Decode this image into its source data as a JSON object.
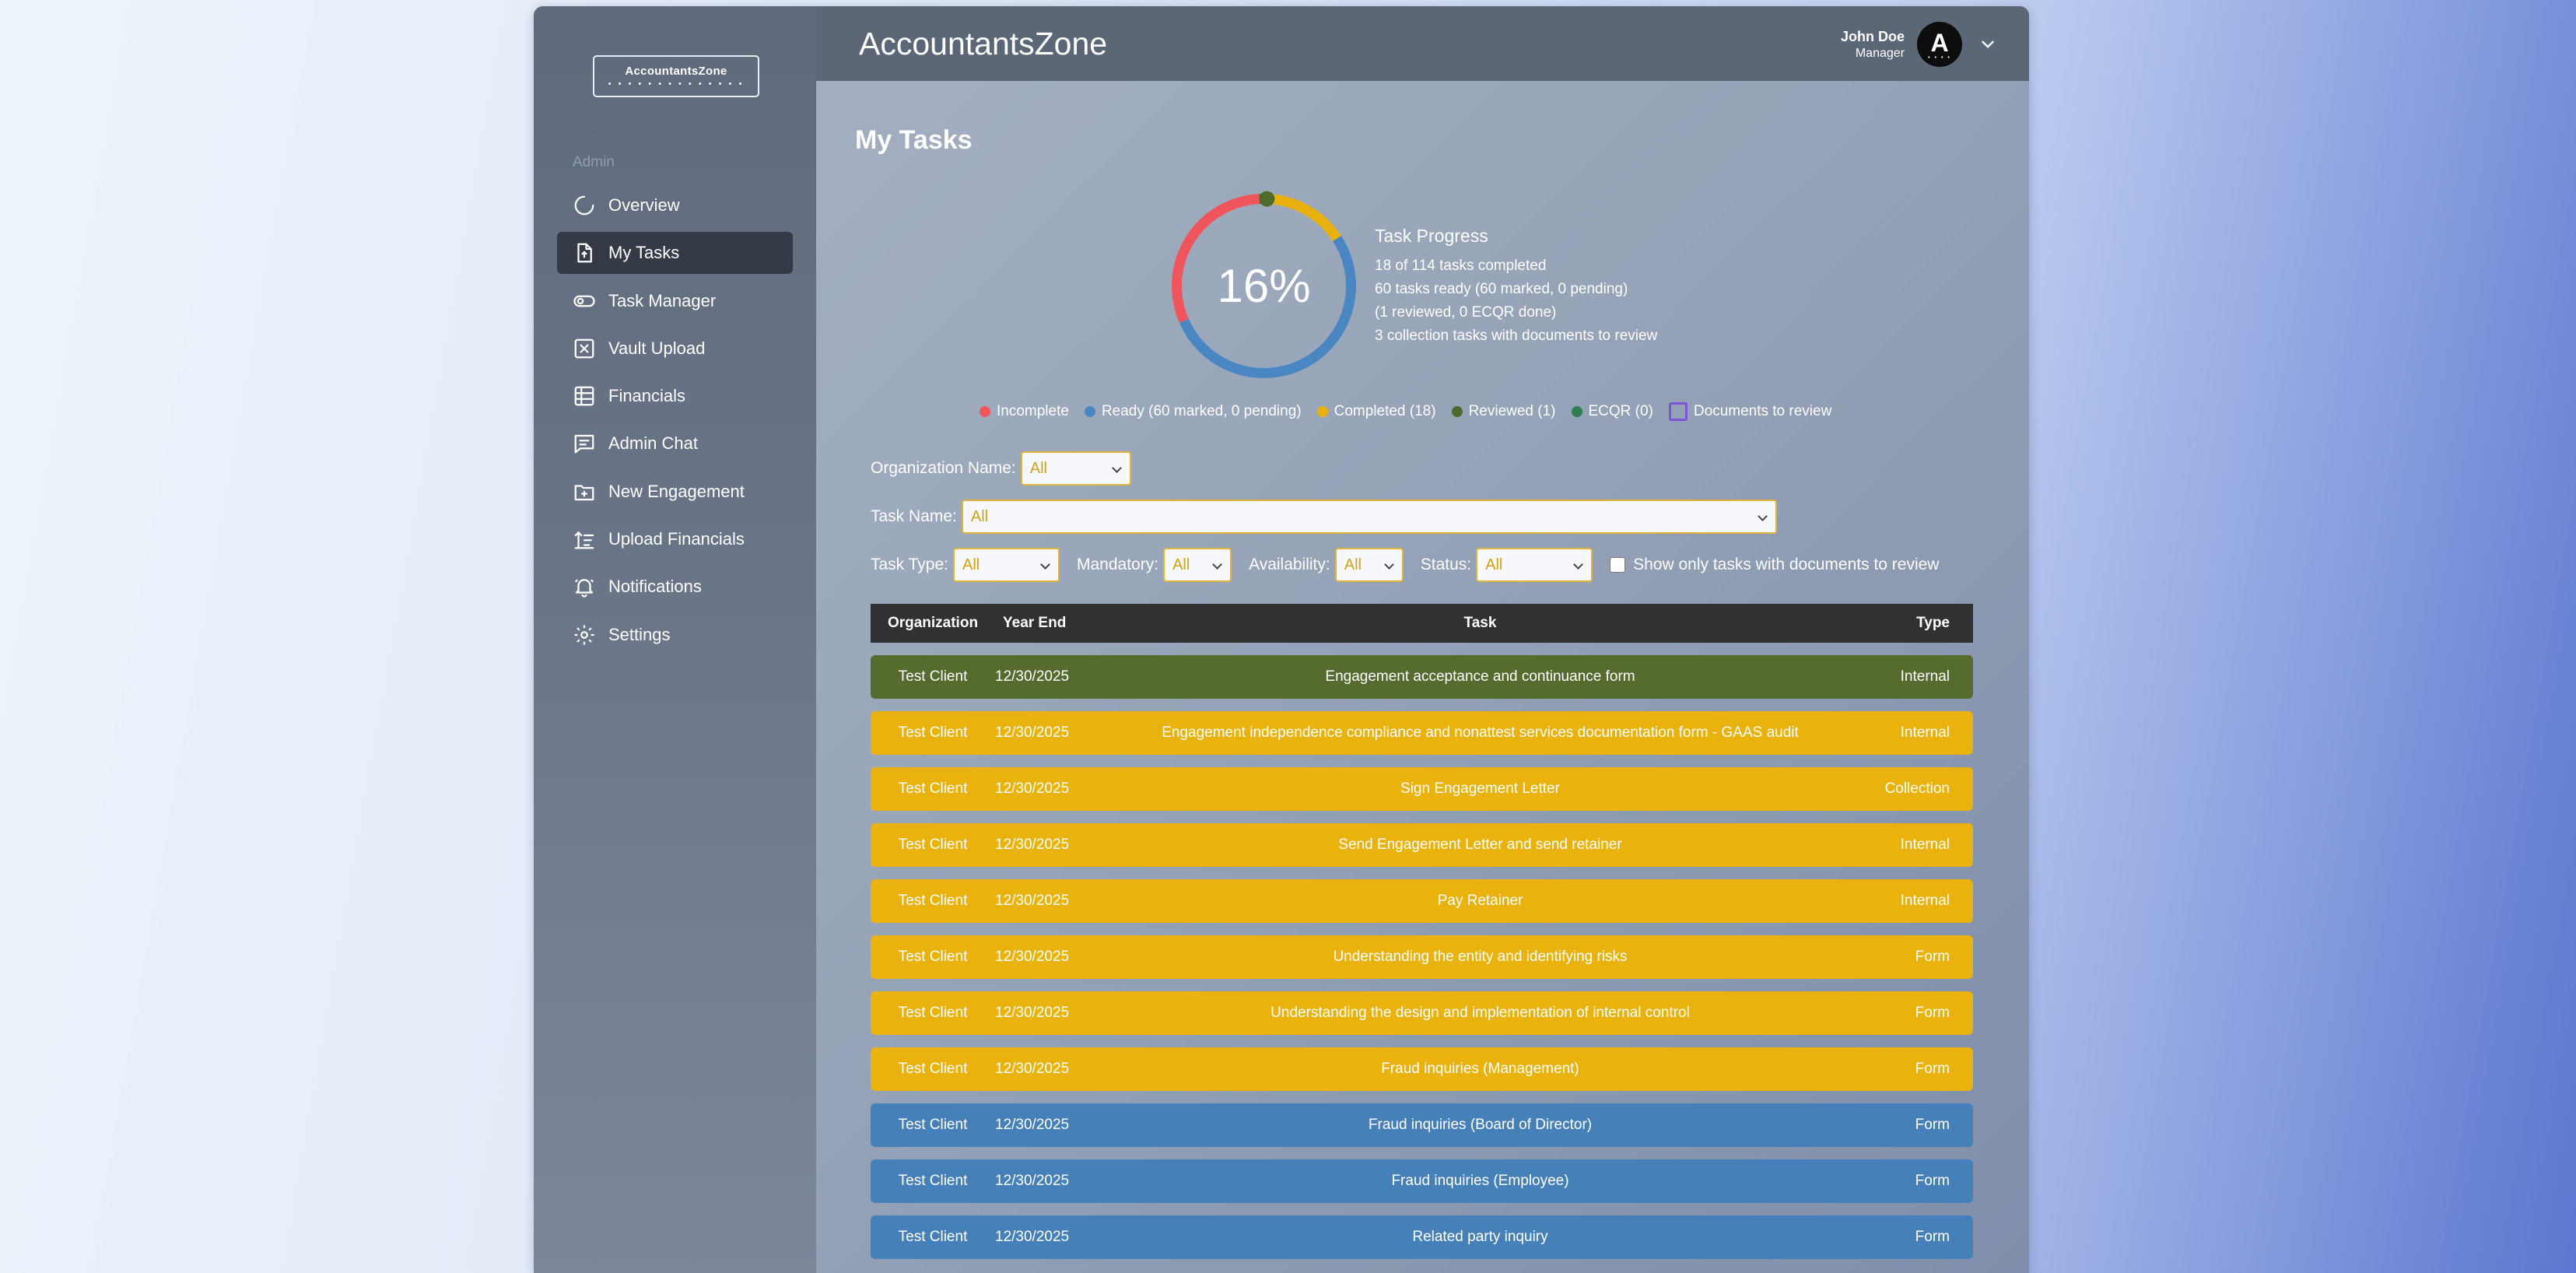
{
  "app": {
    "title": "AccountantsZone",
    "logo_title": "AccountantsZone",
    "logo_dots": "• • • • • • • • • • • •   • •"
  },
  "sidebar": {
    "section_label": "Admin",
    "items": [
      {
        "label": "Overview",
        "icon": "overview-icon"
      },
      {
        "label": "My Tasks",
        "icon": "task-file-icon",
        "active": true
      },
      {
        "label": "Task Manager",
        "icon": "toggle-icon"
      },
      {
        "label": "Vault Upload",
        "icon": "vault-icon"
      },
      {
        "label": "Financials",
        "icon": "table-icon"
      },
      {
        "label": "Admin Chat",
        "icon": "chat-icon"
      },
      {
        "label": "New Engagement",
        "icon": "folder-plus-icon"
      },
      {
        "label": "Upload Financials",
        "icon": "upload-list-icon"
      },
      {
        "label": "Notifications",
        "icon": "bell-icon"
      },
      {
        "label": "Settings",
        "icon": "gear-icon"
      }
    ]
  },
  "header": {
    "user_name": "John Doe",
    "user_role": "Manager",
    "avatar_letter": "A",
    "avatar_sub": "• • • •"
  },
  "page": {
    "title": "My Tasks"
  },
  "progress": {
    "percent_label": "16%",
    "title": "Task Progress",
    "lines": [
      "18 of 114 tasks completed",
      "60 tasks ready (60 marked, 0 pending)",
      "(1 reviewed, 0 ECQR done)",
      "3 collection tasks with documents to review"
    ],
    "segments": [
      {
        "name": "Incomplete",
        "value": 35,
        "color": "#f0555b"
      },
      {
        "name": "Ready",
        "value": 60,
        "color": "#4a86c1"
      },
      {
        "name": "Completed",
        "value": 18,
        "color": "#e8b10d"
      },
      {
        "name": "Reviewed",
        "value": 1,
        "color": "#4f6b2b"
      }
    ]
  },
  "legend": [
    {
      "label": "Incomplete",
      "color": "#f0555b"
    },
    {
      "label": "Ready (60 marked, 0 pending)",
      "color": "#4a86c1"
    },
    {
      "label": "Completed (18)",
      "color": "#e8b10d"
    },
    {
      "label": "Reviewed (1)",
      "color": "#4f6b2b"
    },
    {
      "label": "ECQR (0)",
      "color": "#2f7d52"
    },
    {
      "label": "Documents to review",
      "color": "#7b55d6"
    }
  ],
  "filters": {
    "org_label": "Organization Name:",
    "org_value": "All",
    "task_label": "Task Name:",
    "task_value": "All",
    "type_label": "Task Type:",
    "type_value": "All",
    "mandatory_label": "Mandatory:",
    "mandatory_value": "All",
    "availability_label": "Availability:",
    "availability_value": "All",
    "status_label": "Status:",
    "status_value": "All",
    "docs_only_label": "Show only tasks with documents to review",
    "docs_only_checked": false
  },
  "table": {
    "headers": {
      "org": "Organization",
      "year": "Year End",
      "task": "Task",
      "type": "Type"
    },
    "rows": [
      {
        "org": "Test Client",
        "year": "12/30/2025",
        "task": "Engagement acceptance and continuance form",
        "type": "Internal",
        "color": "#566b2e"
      },
      {
        "org": "Test Client",
        "year": "12/30/2025",
        "task": "Engagement independence compliance and nonattest services documentation form - GAAS audit",
        "type": "Internal",
        "color": "#e9b20d"
      },
      {
        "org": "Test Client",
        "year": "12/30/2025",
        "task": "Sign Engagement Letter",
        "type": "Collection",
        "color": "#e9b20d"
      },
      {
        "org": "Test Client",
        "year": "12/30/2025",
        "task": "Send Engagement Letter and send retainer",
        "type": "Internal",
        "color": "#e9b20d"
      },
      {
        "org": "Test Client",
        "year": "12/30/2025",
        "task": "Pay Retainer",
        "type": "Internal",
        "color": "#e9b20d"
      },
      {
        "org": "Test Client",
        "year": "12/30/2025",
        "task": "Understanding the entity and identifying risks",
        "type": "Form",
        "color": "#e9b20d"
      },
      {
        "org": "Test Client",
        "year": "12/30/2025",
        "task": "Understanding the design and implementation of internal control",
        "type": "Form",
        "color": "#e9b20d"
      },
      {
        "org": "Test Client",
        "year": "12/30/2025",
        "task": "Fraud inquiries (Management)",
        "type": "Form",
        "color": "#e9b20d"
      },
      {
        "org": "Test Client",
        "year": "12/30/2025",
        "task": "Fraud inquiries (Board of Director)",
        "type": "Form",
        "color": "#4680b8"
      },
      {
        "org": "Test Client",
        "year": "12/30/2025",
        "task": "Fraud inquiries (Employee)",
        "type": "Form",
        "color": "#4680b8"
      },
      {
        "org": "Test Client",
        "year": "12/30/2025",
        "task": "Related party inquiry",
        "type": "Form",
        "color": "#4680b8"
      }
    ]
  }
}
